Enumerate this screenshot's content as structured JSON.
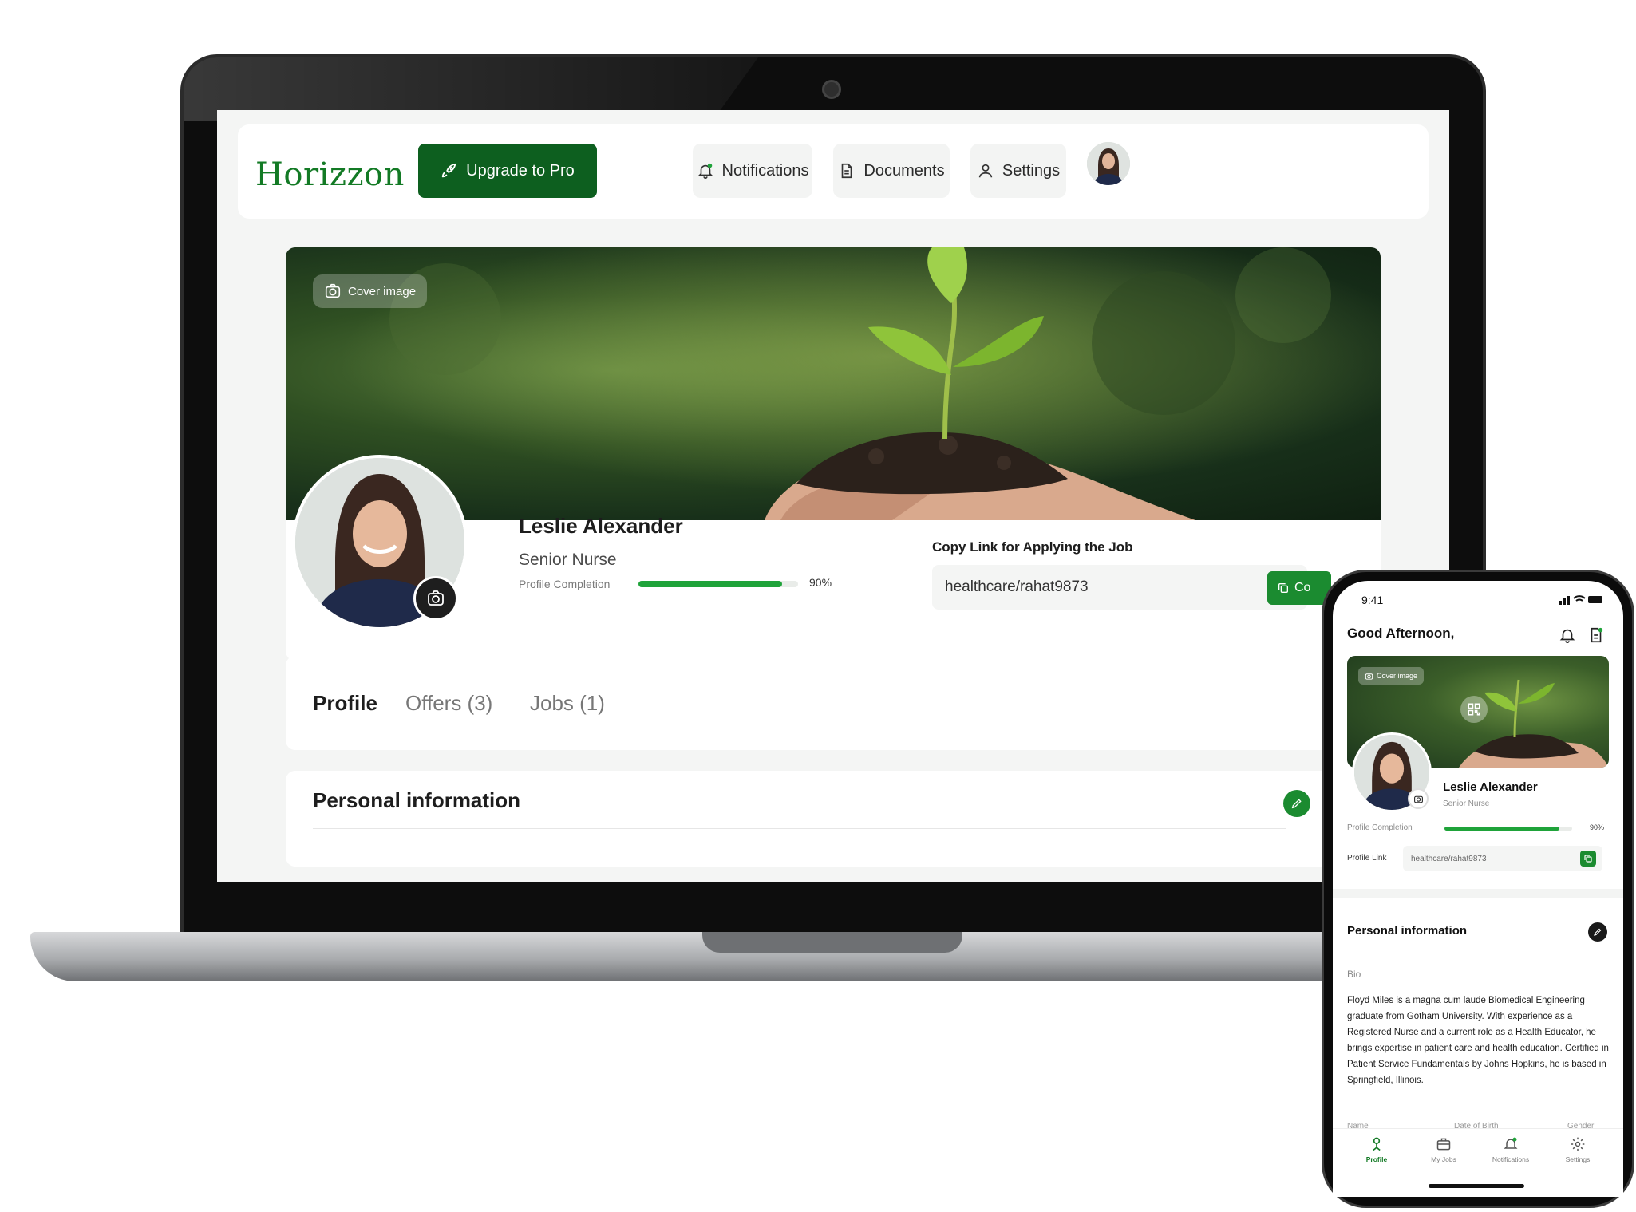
{
  "desktop": {
    "brand": "Horizzon",
    "upgrade_label": "Upgrade to Pro",
    "nav": {
      "notifications": "Notifications",
      "documents": "Documents",
      "settings": "Settings"
    },
    "cover_label": "Cover image",
    "profile": {
      "name": "Leslie Alexander",
      "role": "Senior Nurse",
      "completion_label": "Profile Completion",
      "completion_value": "90%",
      "completion_fraction": 0.9
    },
    "job_link": {
      "label": "Copy Link for Applying the Job",
      "value": "healthcare/rahat9873",
      "copy_label": "Co"
    },
    "tabs": [
      {
        "label": "Profile",
        "active": true
      },
      {
        "label": "Offers (3)",
        "active": false
      },
      {
        "label": "Jobs (1)",
        "active": false
      }
    ],
    "section_title": "Personal information"
  },
  "mobile": {
    "time": "9:41",
    "status_icons": "signal wifi battery",
    "greeting": "Good Afternoon,",
    "cover_label": "Cover image",
    "name": "Leslie Alexander",
    "role": "Senior Nurse",
    "completion_label": "Profile Completion",
    "completion_value": "90%",
    "completion_fraction": 0.9,
    "link_label": "Profile Link",
    "link_value": "healthcare/rahat9873",
    "section_title": "Personal information",
    "bio_label": "Bio",
    "bio": "Floyd Miles is a magna cum laude Biomedical Engineering graduate from Gotham University. With experience as a Registered Nurse and a current role as a Health Educator, he brings expertise in patient care and health education. Certified in Patient Service Fundamentals by Johns Hopkins, he is based in Springfield, Illinois.",
    "columns": [
      "Name",
      "Date of Birth",
      "Gender"
    ],
    "tabbar": [
      {
        "label": "Profile",
        "icon": "person-icon",
        "active": true
      },
      {
        "label": "My Jobs",
        "icon": "briefcase-icon",
        "active": false
      },
      {
        "label": "Notifications",
        "icon": "bell-icon",
        "active": false
      },
      {
        "label": "Settings",
        "icon": "gear-icon",
        "active": false
      }
    ]
  },
  "colors": {
    "brand_green": "#137a25",
    "button_dark_green": "#0d5f1f",
    "accent_green": "#1fa33a"
  }
}
